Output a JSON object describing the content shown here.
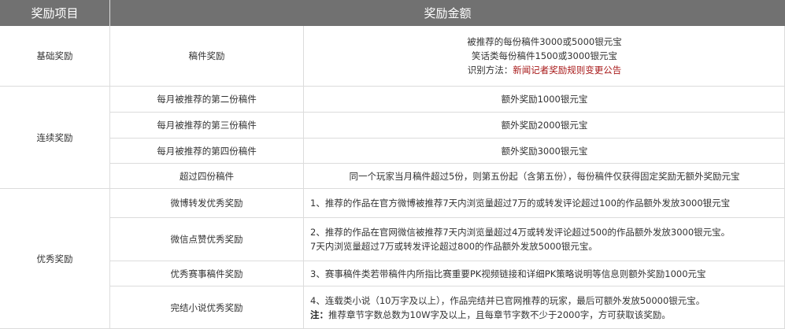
{
  "header": {
    "col1": "奖励项目",
    "col3": "奖励金额"
  },
  "groups": {
    "basic": "基础奖励",
    "continuous": "连续奖励",
    "excellent": "优秀奖励"
  },
  "rows": {
    "manuscript": {
      "name": "稿件奖励",
      "line1": "被推荐的每份稿件3000或5000银元宝",
      "line2": "笑话类每份稿件1500或3000银元宝",
      "line3_label": "识别方法：",
      "line3_link": "新闻记者奖励规则变更公告"
    },
    "second": {
      "name": "每月被推荐的第二份稿件",
      "amount": "额外奖励1000银元宝"
    },
    "third": {
      "name": "每月被推荐的第三份稿件",
      "amount": "额外奖励2000银元宝"
    },
    "fourth": {
      "name": "每月被推荐的第四份稿件",
      "amount": "额外奖励3000银元宝"
    },
    "over_four": {
      "name": "超过四份稿件",
      "amount": "同一个玩家当月稿件超过5份，则第五份起（含第五份），每份稿件仅获得固定奖励无额外奖励元宝"
    },
    "weibo": {
      "name": "微博转发优秀奖励",
      "amount": "1、推荐的作品在官方微博被推荐7天内浏览量超过7万的或转发评论超过100的作品额外发放3000银元宝"
    },
    "wechat": {
      "name": "微信点赞优秀奖励",
      "line1": "2、推荐的作品在官网微信被推荐7天内浏览量超过4万或转发评论超过500的作品额外发放3000银元宝。",
      "line2": "7天内浏览量超过7万或转发评论超过800的作品额外发放5000银元宝。"
    },
    "contest": {
      "name": "优秀赛事稿件奖励",
      "amount": "3、赛事稿件类若带稿件内所指比赛重要PK视频链接和详细PK策略说明等信息则额外奖励1000元宝"
    },
    "novel": {
      "name": "完结小说优秀奖励",
      "line1": "4、连载类小说（10万字及以上），作品完结并已官网推荐的玩家，最后可额外发放50000银元宝。",
      "note_label": "注：",
      "note_text": "推荐章节字数总数为10W字及以上，且每章节字数不少于2000字，方可获取该奖励。"
    }
  },
  "colors": {
    "header_bg": "#717171",
    "border": "#dcdcdc",
    "link": "#a81a1a"
  }
}
